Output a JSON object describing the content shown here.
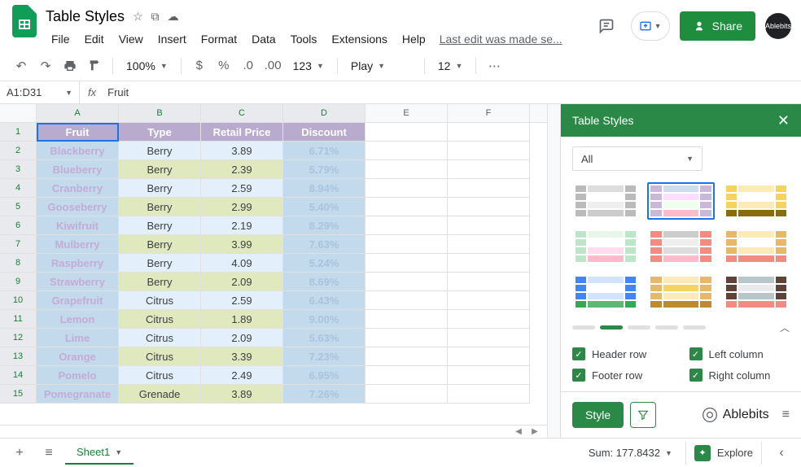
{
  "doc_title": "Table Styles",
  "menus": [
    "File",
    "Edit",
    "View",
    "Insert",
    "Format",
    "Data",
    "Tools",
    "Extensions",
    "Help"
  ],
  "last_edit": "Last edit was made se...",
  "share_label": "Share",
  "avatar": "Ablebits",
  "toolbar": {
    "zoom": "100%",
    "font": "Play",
    "size": "12",
    "fmt": "123"
  },
  "formula": {
    "range": "A1:D31",
    "value": "Fruit"
  },
  "col_letters": [
    "A",
    "B",
    "C",
    "D",
    "E",
    "F"
  ],
  "headers": [
    "Fruit",
    "Type",
    "Retail Price",
    "Discount"
  ],
  "rows": [
    {
      "n": 1,
      "name": "Blackberry",
      "type": "Berry",
      "price": "3.89",
      "disc": "6.71%"
    },
    {
      "n": 2,
      "name": "Blueberry",
      "type": "Berry",
      "price": "2.39",
      "disc": "5.79%"
    },
    {
      "n": 3,
      "name": "Cranberry",
      "type": "Berry",
      "price": "2.59",
      "disc": "8.94%"
    },
    {
      "n": 4,
      "name": "Gooseberry",
      "type": "Berry",
      "price": "2.99",
      "disc": "5.40%"
    },
    {
      "n": 5,
      "name": "Kiwifruit",
      "type": "Berry",
      "price": "2.19",
      "disc": "8.29%"
    },
    {
      "n": 6,
      "name": "Mulberry",
      "type": "Berry",
      "price": "3.99",
      "disc": "7.63%"
    },
    {
      "n": 7,
      "name": "Raspberry",
      "type": "Berry",
      "price": "4.09",
      "disc": "5.24%"
    },
    {
      "n": 8,
      "name": "Strawberry",
      "type": "Berry",
      "price": "2.09",
      "disc": "8.69%"
    },
    {
      "n": 9,
      "name": "Grapefruit",
      "type": "Citrus",
      "price": "2.59",
      "disc": "6.43%"
    },
    {
      "n": 10,
      "name": "Lemon",
      "type": "Citrus",
      "price": "1.89",
      "disc": "9.00%"
    },
    {
      "n": 11,
      "name": "Lime",
      "type": "Citrus",
      "price": "2.09",
      "disc": "5.63%"
    },
    {
      "n": 12,
      "name": "Orange",
      "type": "Citrus",
      "price": "3.39",
      "disc": "7.23%"
    },
    {
      "n": 13,
      "name": "Pomelo",
      "type": "Citrus",
      "price": "2.49",
      "disc": "6.95%"
    },
    {
      "n": 14,
      "name": "Pomegranate",
      "type": "Grenade",
      "price": "3.89",
      "disc": "7.26%"
    }
  ],
  "panel": {
    "title": "Table Styles",
    "filter": "All",
    "opts": {
      "header": "Header row",
      "footer": "Footer row",
      "left": "Left column",
      "right": "Right column"
    },
    "style_btn": "Style",
    "brand": "Ablebits"
  },
  "bottom": {
    "sheet": "Sheet1",
    "sum": "Sum: 177.8432",
    "explore": "Explore"
  }
}
